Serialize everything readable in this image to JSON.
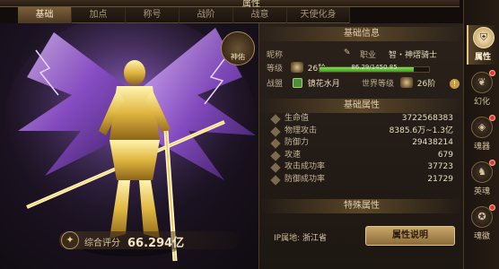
{
  "window": {
    "title": "属性"
  },
  "tabs": [
    {
      "label": "基础",
      "active": true
    },
    {
      "label": "加点"
    },
    {
      "label": "称号"
    },
    {
      "label": "战阶"
    },
    {
      "label": "战意"
    },
    {
      "label": "天使化身"
    }
  ],
  "character": {
    "badge_label": "神佑",
    "score_label": "综合评分",
    "score_value": "66.294亿"
  },
  "basic_info": {
    "header": "基础信息",
    "name_label": "昵称",
    "job_label": "职业",
    "job_value": "智・神熠骑士",
    "level_label": "等级",
    "level_value": "26阶",
    "xp_text": "86.29/1450.85",
    "xp_progress": 0.86,
    "guild_label": "战盟",
    "guild_value": "镜花水月",
    "world_level_label": "世界等级",
    "world_level_value": "26阶",
    "info_icon": "!"
  },
  "base_attributes": {
    "header": "基础属性",
    "items": [
      {
        "name": "生命值",
        "value": "3722568383"
      },
      {
        "name": "物理攻击",
        "value": "8385.6万~1.3亿"
      },
      {
        "name": "防御力",
        "value": "29438214"
      },
      {
        "name": "攻速",
        "value": "679"
      },
      {
        "name": "攻击成功率",
        "value": "37723"
      },
      {
        "name": "防御成功率",
        "value": "21729"
      }
    ]
  },
  "special_attributes": {
    "header": "特殊属性"
  },
  "footer": {
    "ip_label": "IP属地:",
    "ip_value": "浙江省",
    "detail_button": "属性说明"
  },
  "side_nav": [
    {
      "label": "属性",
      "icon": "shield-icon",
      "active": true
    },
    {
      "label": "幻化",
      "icon": "wing-icon",
      "badge": true
    },
    {
      "label": "魂器",
      "icon": "soul-icon",
      "badge": true
    },
    {
      "label": "英魂",
      "icon": "hero-icon",
      "badge": true
    },
    {
      "label": "魂徽",
      "icon": "emblem-icon",
      "badge": true
    }
  ],
  "colors": {
    "accent": "#c9a768",
    "xp_bar": "#5ec235",
    "badge_red": "#e03a2a"
  }
}
